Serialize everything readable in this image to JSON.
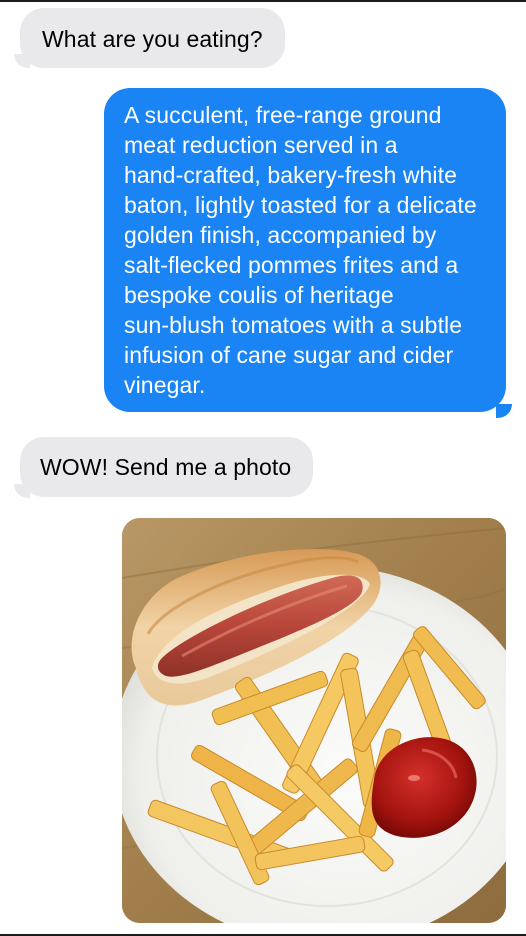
{
  "conversation": {
    "messages": [
      {
        "sender": "incoming",
        "text": "What are you eating?"
      },
      {
        "sender": "outgoing",
        "lines": [
          "A succulent, free-range ground",
          "meat reduction served in a",
          "hand-crafted, bakery-fresh white",
          "baton, lightly toasted for a delicate",
          "golden finish, accompanied by",
          "salt-flecked pommes frites and a",
          "bespoke coulis of heritage",
          "sun-blush tomatoes with a subtle",
          "infusion of cane sugar and cider",
          "vinegar."
        ]
      },
      {
        "sender": "incoming",
        "text": "WOW! Send me a photo"
      }
    ]
  },
  "colors": {
    "incoming_bubble": "#e9e9eb",
    "outgoing_bubble": "#1a84f5",
    "background": "#ffffff"
  }
}
